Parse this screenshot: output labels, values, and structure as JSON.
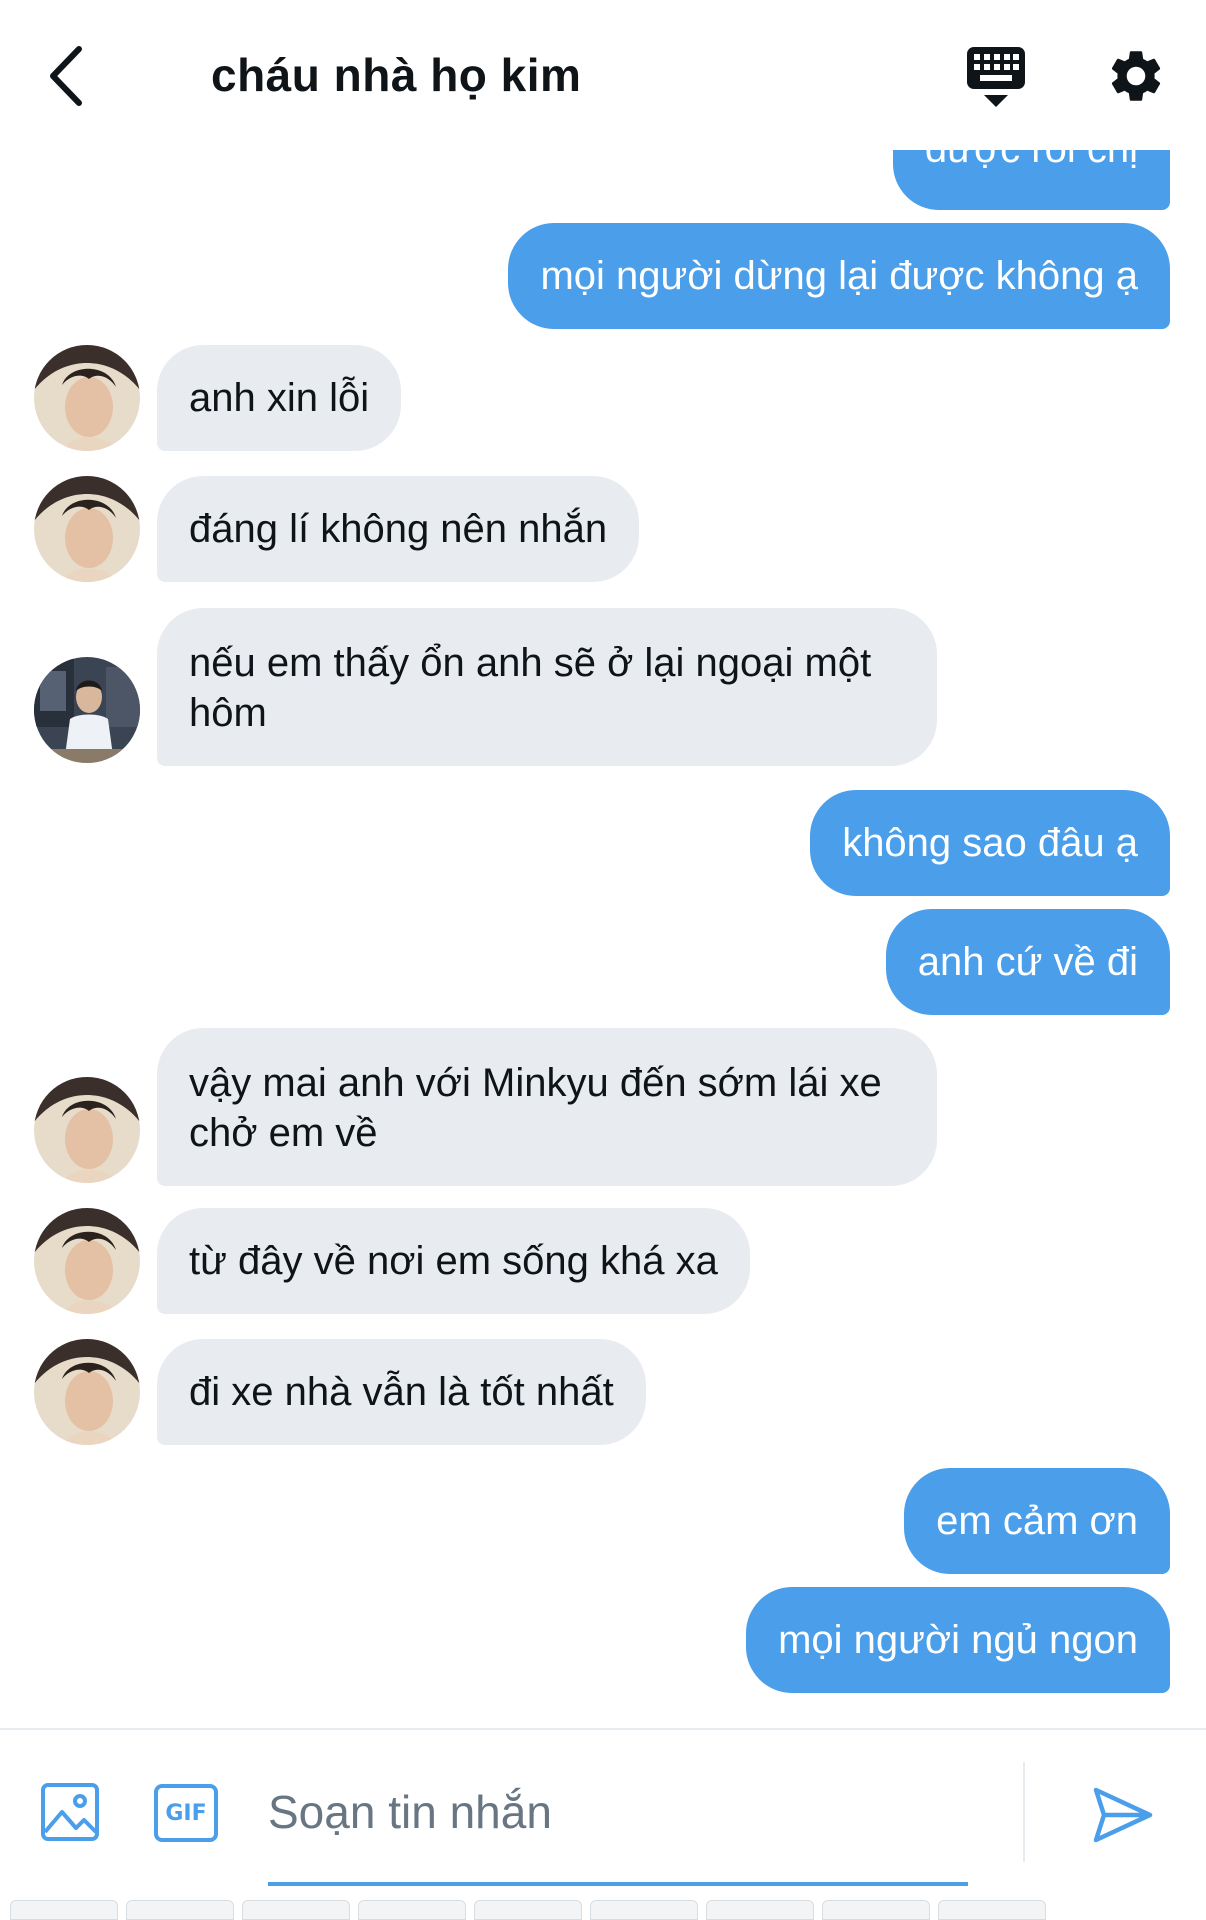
{
  "header": {
    "title": "cháu nhà họ kim",
    "back_icon": "chevron-left-icon",
    "keyboard_icon": "keyboard-icon",
    "settings_icon": "gear-icon"
  },
  "messages": [
    {
      "side": "out",
      "text": "được rồi chị",
      "partial": true
    },
    {
      "side": "out",
      "text": "mọi người dừng lại được không ạ"
    },
    {
      "side": "in",
      "text": "anh xin lỗi",
      "avatar": "avatar-1"
    },
    {
      "side": "in",
      "text": "đáng lí không nên nhắn",
      "avatar": "avatar-1"
    },
    {
      "side": "in",
      "text": "nếu em thấy ổn anh sẽ ở lại ngoại một hôm",
      "avatar": "avatar-2"
    },
    {
      "side": "out",
      "text": "không sao đâu ạ"
    },
    {
      "side": "out",
      "text": "anh cứ về đi"
    },
    {
      "side": "in",
      "text": "vậy mai anh với Minkyu đến sớm lái xe chở em về",
      "avatar": "avatar-1"
    },
    {
      "side": "in",
      "text": "từ đây về nơi em sống khá xa",
      "avatar": "avatar-1"
    },
    {
      "side": "in",
      "text": "đi xe nhà vẫn là tốt nhất",
      "avatar": "avatar-1"
    },
    {
      "side": "out",
      "text": "em cảm ơn"
    },
    {
      "side": "out",
      "text": "mọi người ngủ ngon"
    }
  ],
  "composer": {
    "placeholder": "Soạn tin nhắn",
    "gif_label": "GIF",
    "image_icon": "image-icon",
    "send_icon": "send-icon"
  },
  "colors": {
    "accent": "#4a9eea",
    "incoming_bubble": "#e8ecf0",
    "text": "#0f1419",
    "placeholder": "#687684"
  }
}
